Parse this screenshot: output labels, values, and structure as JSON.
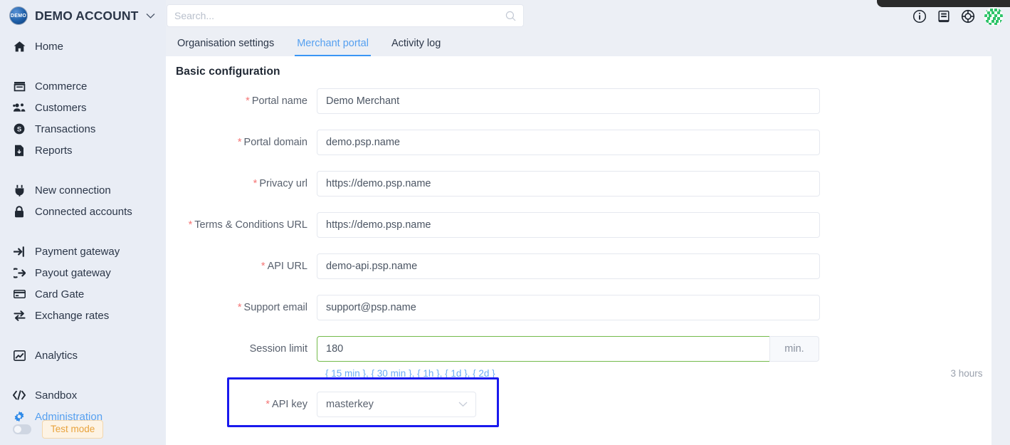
{
  "sidebar": {
    "brand": {
      "logo_text": "DEMO",
      "name": "DEMO ACCOUNT",
      "caret": "⌄"
    },
    "groups": [
      {
        "items": [
          {
            "label": "Home",
            "icon": "home-icon",
            "active": false
          }
        ]
      },
      {
        "items": [
          {
            "label": "Commerce",
            "icon": "store-icon",
            "active": false
          },
          {
            "label": "Customers",
            "icon": "users-icon",
            "active": false
          },
          {
            "label": "Transactions",
            "icon": "dollar-circle-icon",
            "active": false
          },
          {
            "label": "Reports",
            "icon": "report-file-icon",
            "active": false
          }
        ]
      },
      {
        "items": [
          {
            "label": "New connection",
            "icon": "plug-icon",
            "active": false
          },
          {
            "label": "Connected accounts",
            "icon": "lock-icon",
            "active": false
          }
        ]
      },
      {
        "items": [
          {
            "label": "Payment gateway",
            "icon": "sign-in-arrow-icon",
            "active": false
          },
          {
            "label": "Payout gateway",
            "icon": "sign-out-arrow-icon",
            "active": false
          },
          {
            "label": "Card Gate",
            "icon": "credit-card-icon",
            "active": false
          },
          {
            "label": "Exchange rates",
            "icon": "exchange-arrows-icon",
            "active": false
          }
        ]
      },
      {
        "items": [
          {
            "label": "Analytics",
            "icon": "chart-line-icon",
            "active": false
          }
        ]
      },
      {
        "items": [
          {
            "label": "Sandbox",
            "icon": "code-brackets-icon",
            "active": false
          },
          {
            "label": "Administration",
            "icon": "gear-icon",
            "active": true
          }
        ]
      }
    ],
    "test_mode": {
      "label": "Test mode",
      "enabled": false
    }
  },
  "header": {
    "search": {
      "value": "",
      "placeholder": "Search..."
    },
    "icons": [
      {
        "name": "info-circle-icon"
      },
      {
        "name": "book-icon"
      },
      {
        "name": "lifebuoy-icon"
      }
    ],
    "avatar": {
      "name": "user-identicon-avatar",
      "accent": "#36c267"
    }
  },
  "tabs": [
    {
      "label": "Organisation settings",
      "active": false
    },
    {
      "label": "Merchant portal",
      "active": true
    },
    {
      "label": "Activity log",
      "active": false
    }
  ],
  "panel": {
    "title": "Basic configuration",
    "fields": [
      {
        "label": "Portal name",
        "required": true,
        "value": "Demo Merchant"
      },
      {
        "label": "Portal domain",
        "required": true,
        "value": "demo.psp.name"
      },
      {
        "label": "Privacy url",
        "required": true,
        "value": "https://demo.psp.name"
      },
      {
        "label": "Terms & Conditions URL",
        "required": true,
        "value": "https://demo.psp.name"
      },
      {
        "label": "API URL",
        "required": true,
        "value": "demo-api.psp.name"
      },
      {
        "label": "Support email",
        "required": true,
        "value": "support@psp.name"
      }
    ],
    "session_limit": {
      "label": "Session limit",
      "required": false,
      "value": "180",
      "suffix": "min.",
      "presets": "{ 15 min }, { 30 min }, { 1h }, { 1d }, { 2d }",
      "computed": "3 hours",
      "border_color": "#73bb4b"
    },
    "api_key": {
      "label": "API key",
      "required": true,
      "value": "masterkey",
      "highlight_color": "#1a1aee"
    }
  },
  "colors": {
    "accent_blue": "#56a0f0",
    "required_red": "#f57676",
    "test_mode_orange": "#e8a33d",
    "sidebar_bg": "#e9edf5",
    "page_bg": "#eceff5"
  }
}
